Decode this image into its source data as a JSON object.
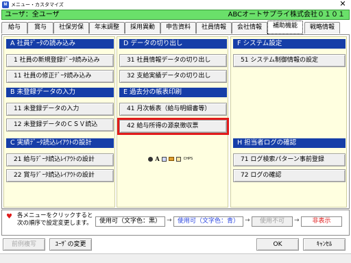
{
  "window": {
    "title": "メニュー・カスタマイズ",
    "close": "✕"
  },
  "userbar": {
    "user": "ユーザ：全ユーザ",
    "company": "ABCオートサプライ株式会社０１０１"
  },
  "tabs": [
    "給与",
    "賞与",
    "社保労保",
    "年末調整",
    "採用異動",
    "申告資料",
    "社員情報",
    "会社情報",
    "補助機能",
    "戦略情報"
  ],
  "sections": {
    "A": {
      "title": "A  社員ﾃﾞｰﾀの読み込み",
      "items": [
        "1  社員の新規登録ﾃﾞｰﾀ読み込み",
        "11  社員の修正ﾃﾞｰﾀ読み込み"
      ]
    },
    "B": {
      "title": "B  未登録データの入力",
      "items": [
        "11  未登録データの入力",
        "12  未登録データのＣＳＶ読込"
      ]
    },
    "C": {
      "title": "C  実績ﾃﾞｰﾀ読込ﾚｲｱｳﾄの設計",
      "items": [
        "21  給与ﾃﾞｰﾀ読込ﾚｲｱｳﾄの設計",
        "22  賞与ﾃﾞｰﾀ読込ﾚｲｱｳﾄの設計"
      ]
    },
    "D": {
      "title": "D  データの切り出し",
      "items": [
        "31  社員情報データの切り出し",
        "32  支給実績データの切り出し"
      ]
    },
    "E": {
      "title": "E  過去分の帳表印刷",
      "items": [
        "41  月次帳表（給与明細書等）",
        "42  給与所得の源泉徴収票"
      ]
    },
    "F": {
      "title": "F  システム設定",
      "items": [
        "51  システム制御情報の設定"
      ]
    },
    "H": {
      "title": "H  担当者ログの確認",
      "items": [
        "71  ログ検索パターン事前登録",
        "72  ログの確認"
      ]
    }
  },
  "icons_row": {
    "letter": "A",
    "text": "CHPS"
  },
  "legend": {
    "text": "各メニューをクリックすると次の順序で設定変更します。",
    "usable_black": "使用可（文字色：黒）",
    "usable_blue": "使用可（文字色：青）",
    "unusable": "使用不可",
    "hidden": "非表示",
    "arrow": "→"
  },
  "buttons": {
    "copy": "前例複写",
    "change_user": "ﾕｰｻﾞの変更",
    "ok": "OK",
    "cancel": "ｷｬﾝｾﾙ"
  },
  "colors": {
    "accent": "#163ea8",
    "userbar": "#6ae06a",
    "highlight": "#e21b1b",
    "panel": "#ffffe0"
  }
}
